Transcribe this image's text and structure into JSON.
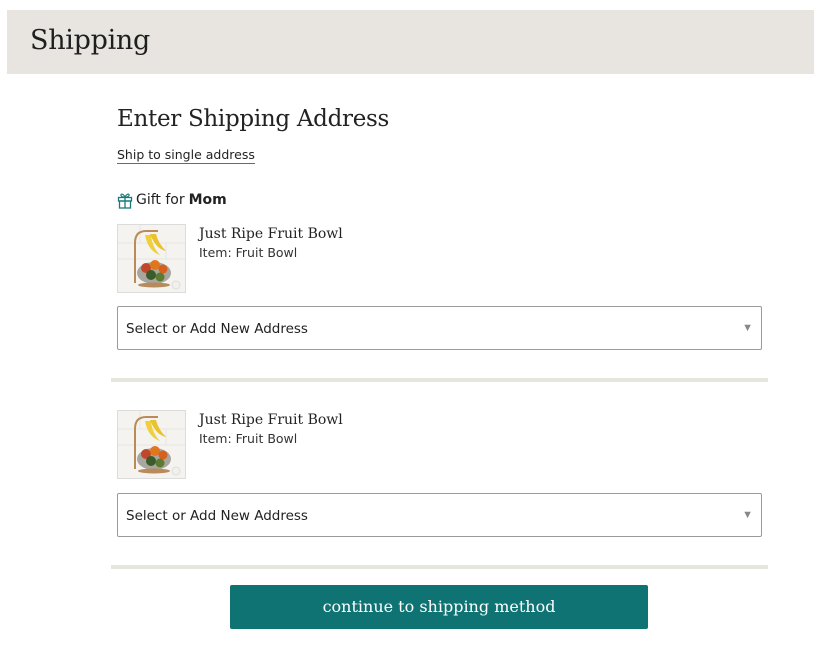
{
  "header": {
    "title": "Shipping"
  },
  "main": {
    "section_title": "Enter Shipping Address",
    "single_address_link": "Ship to single address",
    "gift": {
      "prefix": "Gift for",
      "recipient": "Mom",
      "icon": "gift-icon"
    },
    "items": [
      {
        "name": "Just Ripe Fruit Bowl",
        "subtitle": "Item: Fruit Bowl",
        "image": "fruit-bowl-thumbnail",
        "address_select": {
          "selected": "Select or Add New Address",
          "arrow": "▼"
        }
      },
      {
        "name": "Just Ripe Fruit Bowl",
        "subtitle": "Item: Fruit Bowl",
        "image": "fruit-bowl-thumbnail",
        "address_select": {
          "selected": "Select or Add New Address",
          "arrow": "▼"
        }
      }
    ],
    "continue_label": "continue to shipping method"
  },
  "colors": {
    "header_bg": "#e8e5e0",
    "accent": "#0e7372",
    "divider": "#e6e5de",
    "link_underline": "#1a8a8a"
  }
}
